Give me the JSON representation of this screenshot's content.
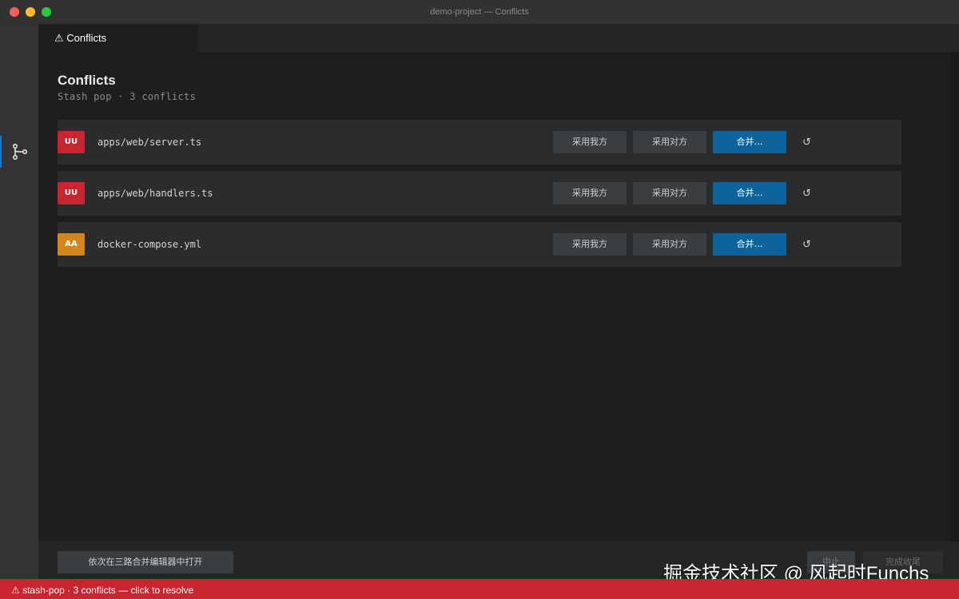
{
  "window": {
    "title": "demo-project — Conflicts"
  },
  "tab": {
    "label": "⚠ Conflicts"
  },
  "page": {
    "title": "Conflicts",
    "subtitle": "Stash pop · 3 conflicts"
  },
  "conflicts": [
    {
      "status": "UU",
      "file": "apps/web/server.ts"
    },
    {
      "status": "UU",
      "file": "apps/web/handlers.ts"
    },
    {
      "status": "AA",
      "file": "docker-compose.yml"
    }
  ],
  "actions": {
    "ours": "采用我方",
    "theirs": "采用对方",
    "merge": "合并…",
    "revert": "↺"
  },
  "footer": {
    "open_3way": "依次在三路合并编辑器中打开",
    "abort": "中止",
    "finish": "完成收尾"
  },
  "watermark": "掘金技术社区 @ 风起时Funchs",
  "statusbar": {
    "text": "⚠ stash-pop · 3 conflicts — click to resolve"
  },
  "colors": {
    "accent": "#0e639c",
    "conflict_uu": "#c9252f",
    "conflict_aa": "#d4861c",
    "statusbar": "#c9252f"
  },
  "icons": {
    "activity": "source-control-icon"
  }
}
